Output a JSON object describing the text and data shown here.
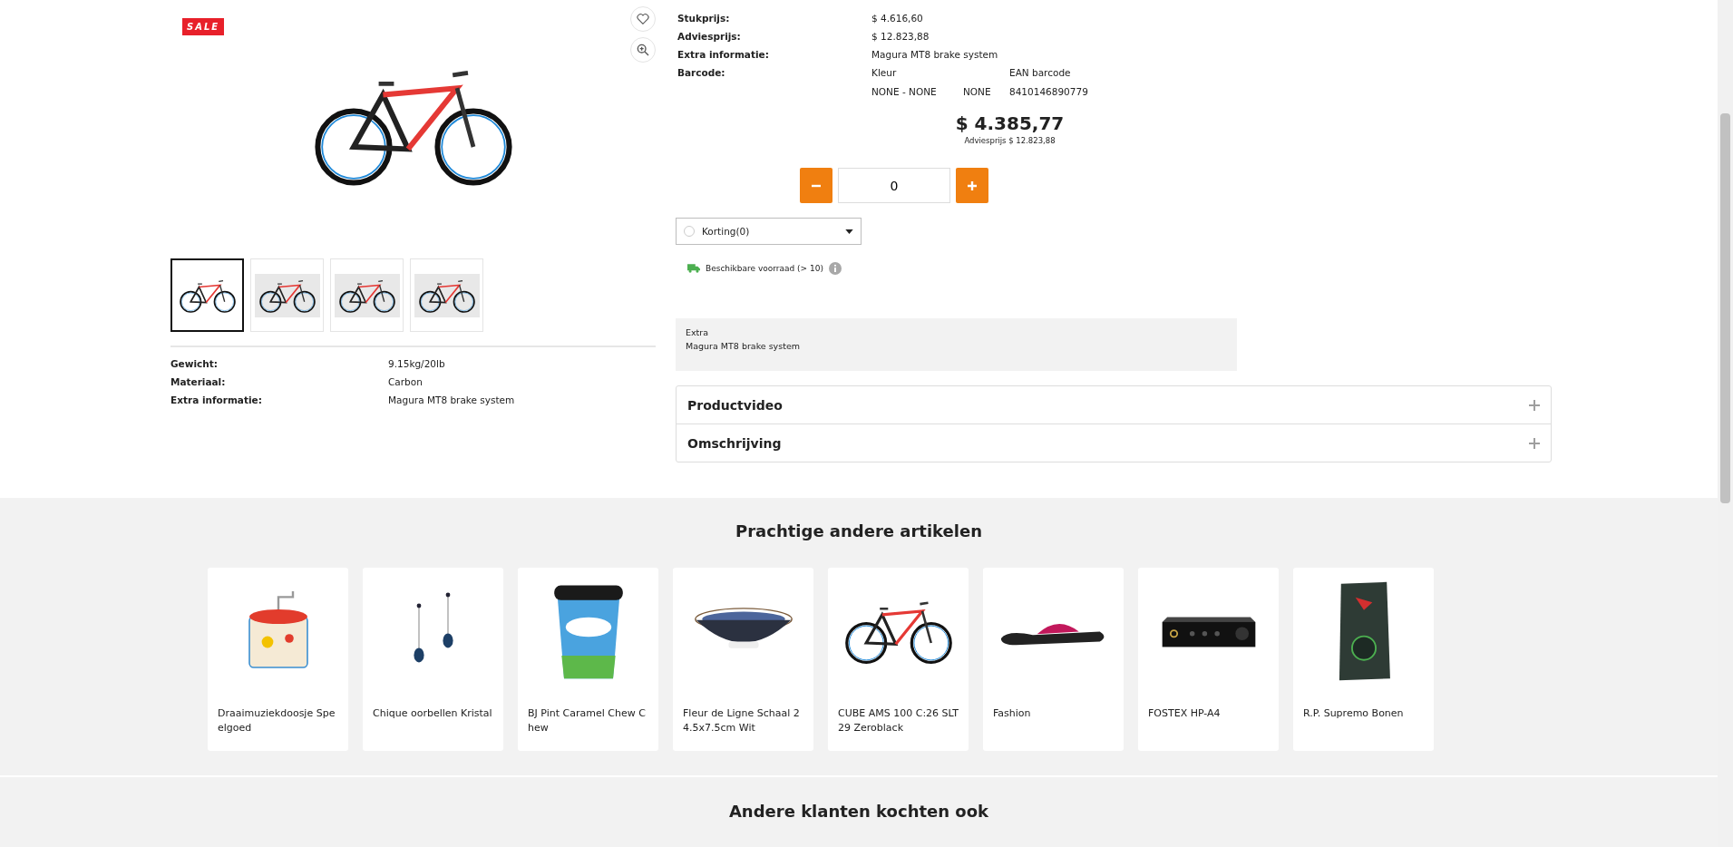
{
  "gallery": {
    "sale_badge": "SALE",
    "thumbnails": [
      {
        "selected": true
      },
      {
        "selected": false
      },
      {
        "selected": false
      },
      {
        "selected": false
      }
    ]
  },
  "specs_left": [
    {
      "label": "Gewicht:",
      "value": "9.15kg/20lb"
    },
    {
      "label": "Materiaal:",
      "value": "Carbon"
    },
    {
      "label": "Extra informatie:",
      "value": "Magura MT8 brake system"
    }
  ],
  "specs_right": [
    {
      "label": "Stukprijs:",
      "value": "$ 4.616,60"
    },
    {
      "label": "Adviesprijs:",
      "value": "$ 12.823,88"
    },
    {
      "label": "Extra informatie:",
      "value": "Magura MT8 brake system"
    }
  ],
  "barcode": {
    "label": "Barcode:",
    "color_header": "Kleur",
    "ean_header": "EAN barcode",
    "color_value": "NONE - NONE",
    "size_value": "NONE",
    "ean_value": "8410146890779"
  },
  "price": "$ 4.385,77",
  "advice_price": "Adviesprijs $ 12.823,88",
  "quantity": {
    "value": "0"
  },
  "discount": {
    "label": "Korting(0)",
    "checked": false
  },
  "stock": "Beschikbare voorraad (> 10)",
  "extra": {
    "title": "Extra",
    "text": "Magura MT8 brake system"
  },
  "accordion": [
    {
      "title": "Productvideo",
      "expanded": false
    },
    {
      "title": "Omschrijving",
      "expanded": false
    }
  ],
  "related": {
    "title": "Prachtige andere artikelen",
    "items": [
      {
        "name": "Draaimuziekdoosje Speelgoed",
        "kind": "musicbox"
      },
      {
        "name": "Chique oorbellen Kristal",
        "kind": "earrings"
      },
      {
        "name": "BJ Pint Caramel Chew Chew",
        "kind": "tub"
      },
      {
        "name": "Fleur de Ligne Schaal 24.5x7.5cm Wit",
        "kind": "bowl"
      },
      {
        "name": "CUBE AMS 100 C:26 SLT 29 Zeroblack",
        "kind": "bike"
      },
      {
        "name": "Fashion",
        "kind": "sandal"
      },
      {
        "name": "FOSTEX HP-A4",
        "kind": "amplifier"
      },
      {
        "name": "R.P. Supremo Bonen",
        "kind": "coffee"
      }
    ]
  },
  "also_bought": {
    "title": "Andere klanten kochten ook"
  }
}
